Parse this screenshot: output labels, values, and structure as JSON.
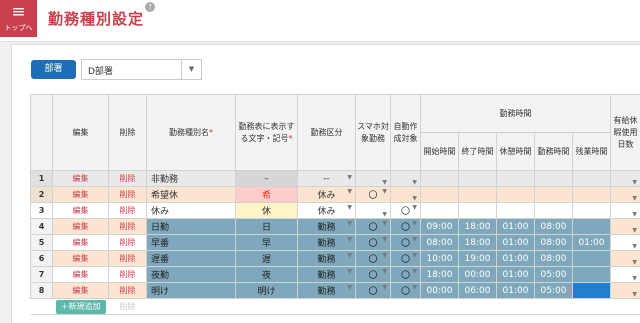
{
  "header": {
    "home_icon": "≡",
    "home_label": "トップへ",
    "title": "勤務種別設定",
    "help_icon": "?"
  },
  "filter": {
    "dept_button": "部署",
    "dept_value": "D部署",
    "dropdown_icon": "▼"
  },
  "columns": {
    "edit": "編集",
    "delete": "削除",
    "name": "勤務種別名",
    "symbol": "勤務表に表示する文字・記号",
    "category": "勤務区分",
    "smartphone": "スマホ対象勤務",
    "auto": "自動作成対象",
    "work_time": "勤務時間",
    "start": "開始時間",
    "end": "終了時間",
    "break": "休憩時間",
    "work": "勤務時間",
    "overtime": "残業時間",
    "paid_leave": "有給休暇使用日数",
    "required_mark": "*"
  },
  "rows": [
    {
      "no": "1",
      "edit": "編集",
      "delete": "削除",
      "name": "非勤務",
      "symbol": "–",
      "category": "--",
      "smartphone": "",
      "auto": "",
      "start": "",
      "end": "",
      "break": "",
      "work": "",
      "overtime": "",
      "paid": ""
    },
    {
      "no": "2",
      "edit": "編集",
      "delete": "削除",
      "name": "希望休",
      "symbol": "希",
      "category": "休み",
      "smartphone": "〇",
      "auto": "",
      "start": "",
      "end": "",
      "break": "",
      "work": "",
      "overtime": "",
      "paid": ""
    },
    {
      "no": "3",
      "edit": "編集",
      "delete": "削除",
      "name": "休み",
      "symbol": "休",
      "category": "休み",
      "smartphone": "",
      "auto": "〇",
      "start": "",
      "end": "",
      "break": "",
      "work": "",
      "overtime": "",
      "paid": ""
    },
    {
      "no": "4",
      "edit": "編集",
      "delete": "削除",
      "name": "日勤",
      "symbol": "日",
      "category": "勤務",
      "smartphone": "〇",
      "auto": "〇",
      "start": "09:00",
      "end": "18:00",
      "break": "01:00",
      "work": "08:00",
      "overtime": "",
      "paid": ""
    },
    {
      "no": "5",
      "edit": "編集",
      "delete": "削除",
      "name": "早番",
      "symbol": "早",
      "category": "勤務",
      "smartphone": "〇",
      "auto": "〇",
      "start": "08:00",
      "end": "18:00",
      "break": "01:00",
      "work": "08:00",
      "overtime": "01:00",
      "paid": ""
    },
    {
      "no": "6",
      "edit": "編集",
      "delete": "削除",
      "name": "遅番",
      "symbol": "遅",
      "category": "勤務",
      "smartphone": "〇",
      "auto": "〇",
      "start": "10:00",
      "end": "19:00",
      "break": "01:00",
      "work": "08:00",
      "overtime": "",
      "paid": ""
    },
    {
      "no": "7",
      "edit": "編集",
      "delete": "削除",
      "name": "夜勤",
      "symbol": "夜",
      "category": "勤務",
      "smartphone": "〇",
      "auto": "〇",
      "start": "18:00",
      "end": "00:00",
      "break": "01:00",
      "work": "05:00",
      "overtime": "",
      "paid": ""
    },
    {
      "no": "8",
      "edit": "編集",
      "delete": "削除",
      "name": "明け",
      "symbol": "明け",
      "category": "勤務",
      "smartphone": "〇",
      "auto": "〇",
      "start": "00:00",
      "end": "06:00",
      "break": "01:00",
      "work": "05:00",
      "overtime": "",
      "paid": ""
    }
  ],
  "footer": {
    "add_button": "＋新規追加",
    "delete_label": "削除"
  },
  "colors": {
    "accent": "#c9404e",
    "primary": "#1f6fb7",
    "work_row": "#7fa8bd",
    "add_button": "#5fb8a8"
  }
}
